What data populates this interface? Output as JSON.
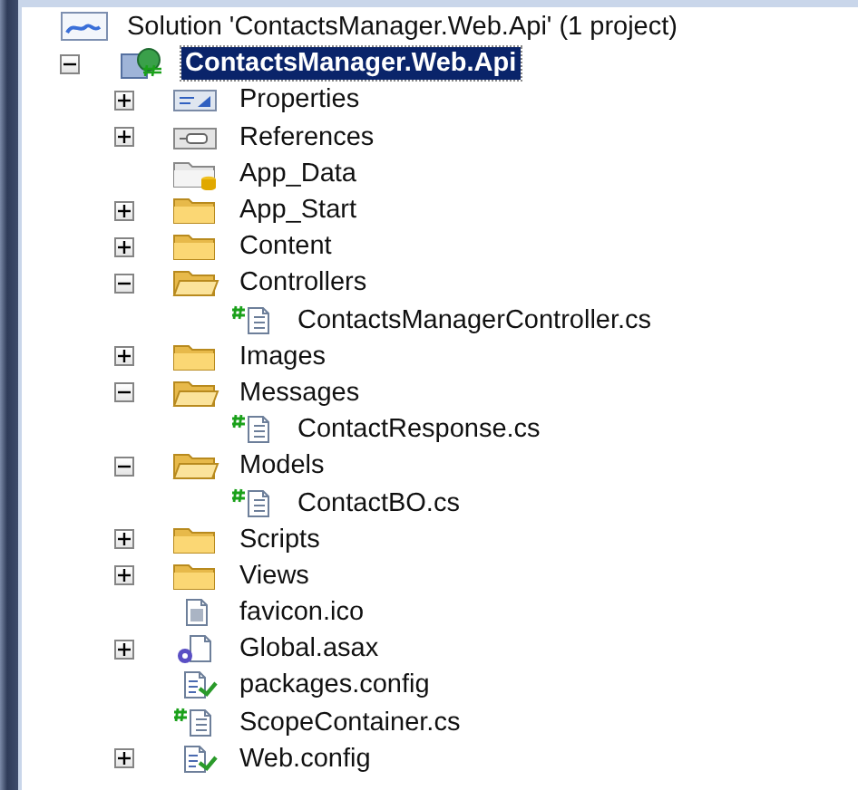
{
  "solution": {
    "label": "Solution 'ContactsManager.Web.Api' (1 project)",
    "project": {
      "label": "ContactsManager.Web.Api",
      "selected": true,
      "expanded": true,
      "children": [
        {
          "label": "Properties",
          "kind": "properties",
          "expanded": false
        },
        {
          "label": "References",
          "kind": "references",
          "expanded": false
        },
        {
          "label": "App_Data",
          "kind": "data-folder"
        },
        {
          "label": "App_Start",
          "kind": "folder",
          "expanded": false
        },
        {
          "label": "Content",
          "kind": "folder",
          "expanded": false
        },
        {
          "label": "Controllers",
          "kind": "folder",
          "expanded": true,
          "children": [
            {
              "label": "ContactsManagerController.cs",
              "kind": "cs"
            }
          ]
        },
        {
          "label": "Images",
          "kind": "folder",
          "expanded": false
        },
        {
          "label": "Messages",
          "kind": "folder",
          "expanded": true,
          "children": [
            {
              "label": "ContactResponse.cs",
              "kind": "cs"
            }
          ]
        },
        {
          "label": "Models",
          "kind": "folder",
          "expanded": true,
          "children": [
            {
              "label": "ContactBO.cs",
              "kind": "cs"
            }
          ]
        },
        {
          "label": "Scripts",
          "kind": "folder",
          "expanded": false
        },
        {
          "label": "Views",
          "kind": "folder",
          "expanded": false
        },
        {
          "label": "favicon.ico",
          "kind": "ico"
        },
        {
          "label": "Global.asax",
          "kind": "asax",
          "expanded": false
        },
        {
          "label": "packages.config",
          "kind": "config"
        },
        {
          "label": "ScopeContainer.cs",
          "kind": "cs"
        },
        {
          "label": "Web.config",
          "kind": "config",
          "expanded": false
        }
      ]
    }
  }
}
